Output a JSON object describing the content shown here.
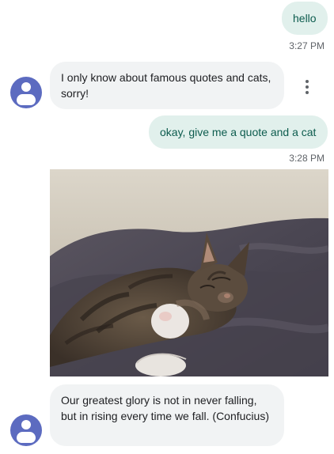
{
  "messages": {
    "user_1": {
      "text": "hello",
      "time": "3:27 PM"
    },
    "bot_1": {
      "text": "I only know about famous quotes and cats, sorry!"
    },
    "user_2": {
      "text": "okay, give me a quote and a cat",
      "time": "3:28 PM"
    },
    "bot_2": {
      "text": "Our greatest glory is not in never falling, but in rising every time we fall. (Confucius)"
    }
  },
  "icons": {
    "avatar": "person-avatar-icon",
    "more": "more-vert-icon"
  },
  "colors": {
    "user_bubble": "#e1f0ec",
    "user_text": "#0d5c4e",
    "bot_bubble": "#f1f3f4",
    "avatar": "#5c6bc0",
    "timestamp": "#5f6368"
  }
}
